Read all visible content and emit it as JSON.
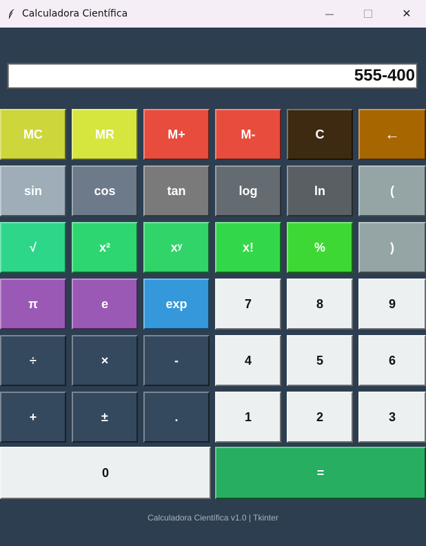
{
  "window": {
    "title": "Calculadora Científica",
    "minimize_glyph": "—",
    "close_glyph": "✕"
  },
  "display": {
    "value": "555-400"
  },
  "colors": {
    "background": "#2c3e50",
    "mc_mr": "#d4e040",
    "memory_add_sub": "#e74c3c",
    "clear": "#3e2a10",
    "backspace": "#a86600",
    "trig": "#6c7a89",
    "paren": "#95a5a6",
    "power_ops": "#2ecc71",
    "constants": "#9b59b6",
    "exp": "#3498db",
    "operators": "#34495e",
    "digits": "#ecf0f1",
    "equals": "#27ae60"
  },
  "buttons": {
    "mc": "MC",
    "mr": "MR",
    "m_plus": "M+",
    "m_minus": "M-",
    "clear": "C",
    "backspace": "←",
    "sin": "sin",
    "cos": "cos",
    "tan": "tan",
    "log": "log",
    "ln": "ln",
    "open_paren": "(",
    "sqrt": "√",
    "square": "x²",
    "power": "xʸ",
    "factorial": "x!",
    "percent": "%",
    "close_paren": ")",
    "pi": "π",
    "e": "e",
    "exp": "exp",
    "seven": "7",
    "eight": "8",
    "nine": "9",
    "divide": "÷",
    "multiply": "×",
    "minus": "-",
    "four": "4",
    "five": "5",
    "six": "6",
    "plus": "+",
    "plus_minus": "±",
    "decimal": ".",
    "one": "1",
    "two": "2",
    "three": "3",
    "zero": "0",
    "equals": "="
  },
  "footer": {
    "text": "Calculadora Científica v1.0 | Tkinter"
  }
}
